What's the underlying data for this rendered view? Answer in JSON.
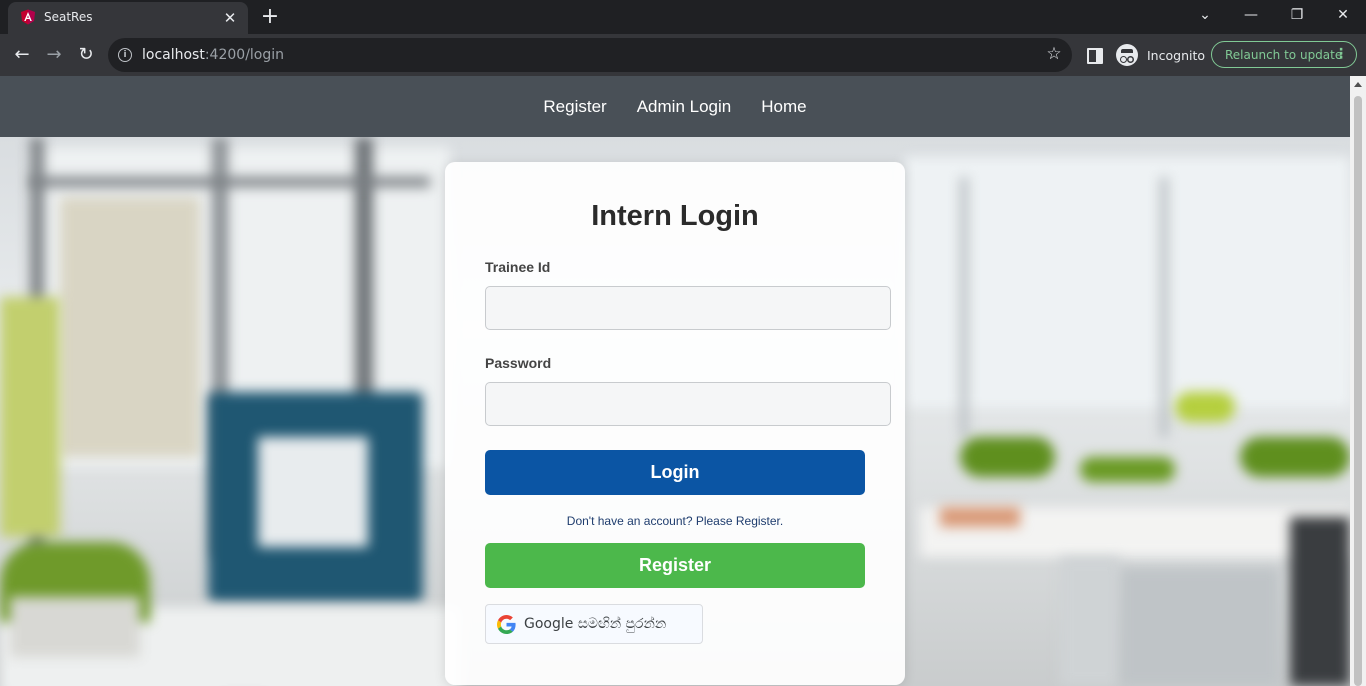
{
  "browser": {
    "tab_title": "SeatRes",
    "tab_close": "✕",
    "new_tab": "+",
    "url_host": "localhost",
    "url_path": ":4200/login",
    "info_symbol": "i",
    "star_symbol": "☆",
    "incognito_label": "Incognito",
    "relaunch_label": "Relaunch to update",
    "relaunch_menu": "⋮",
    "window_controls": {
      "tab_search": "⌄",
      "minimize": "—",
      "restore": "❐",
      "close": "✕"
    },
    "nav": {
      "back": "←",
      "forward": "→",
      "reload": "↻"
    }
  },
  "navbar": {
    "links": [
      "Register",
      "Admin Login",
      "Home"
    ]
  },
  "login": {
    "title": "Intern Login",
    "trainee_label": "Trainee Id",
    "trainee_value": "",
    "password_label": "Password",
    "password_value": "",
    "login_button": "Login",
    "register_hint": "Don't have an account? Please Register.",
    "register_button": "Register",
    "google_button": "Google සමඟින් පුරන්න"
  },
  "colors": {
    "navbar_bg": "#495057",
    "login_button": "#0b55a4",
    "register_button": "#4cb84b",
    "incognito_accent": "#81c995"
  }
}
